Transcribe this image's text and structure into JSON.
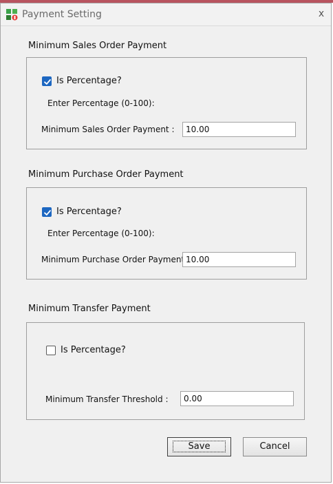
{
  "window": {
    "title": "Payment Setting",
    "close_glyph": "x"
  },
  "sections": {
    "sales": {
      "title": "Minimum Sales Order Payment",
      "is_percentage_label": "Is Percentage?",
      "is_percentage": true,
      "hint": "Enter Percentage (0-100):",
      "field_label": "Minimum Sales Order Payment :",
      "value": "10.00"
    },
    "purchase": {
      "title": "Minimum Purchase Order Payment",
      "is_percentage_label": "Is Percentage?",
      "is_percentage": true,
      "hint": "Enter Percentage (0-100):",
      "field_label": "Minimum Purchase Order Payment :",
      "value": "10.00"
    },
    "transfer": {
      "title": "Minimum Transfer Payment",
      "is_percentage_label": "Is Percentage?",
      "is_percentage": false,
      "field_label": "Minimum Transfer Threshold :",
      "value": "0.00"
    }
  },
  "buttons": {
    "save": "Save",
    "cancel": "Cancel"
  },
  "colors": {
    "checkbox_checked": "#1d67c1",
    "top_accent": "#b8545f"
  }
}
